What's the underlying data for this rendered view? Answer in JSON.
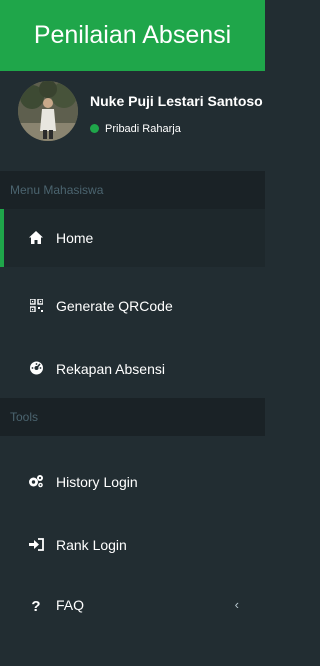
{
  "brand": {
    "title": "Penilaian Absensi"
  },
  "user": {
    "name": "Nuke Puji Lestari Santoso",
    "status": "Pribadi Raharja"
  },
  "sections": {
    "menu_header": "Menu Mahasiswa",
    "tools_header": "Tools"
  },
  "menu": {
    "home": {
      "label": "Home",
      "icon": "home-icon"
    },
    "qrcode": {
      "label": "Generate QRCode",
      "icon": "qrcode-icon"
    },
    "rekapan": {
      "label": "Rekapan Absensi",
      "icon": "dashboard-icon"
    }
  },
  "tools": {
    "history": {
      "label": "History Login",
      "icon": "gears-icon"
    },
    "rank": {
      "label": "Rank Login",
      "icon": "sign-in-icon"
    },
    "faq": {
      "label": "FAQ",
      "icon": "question-icon"
    }
  },
  "colors": {
    "brand": "#1fa64a",
    "sidebar": "#222d32",
    "header": "#1a2226"
  }
}
